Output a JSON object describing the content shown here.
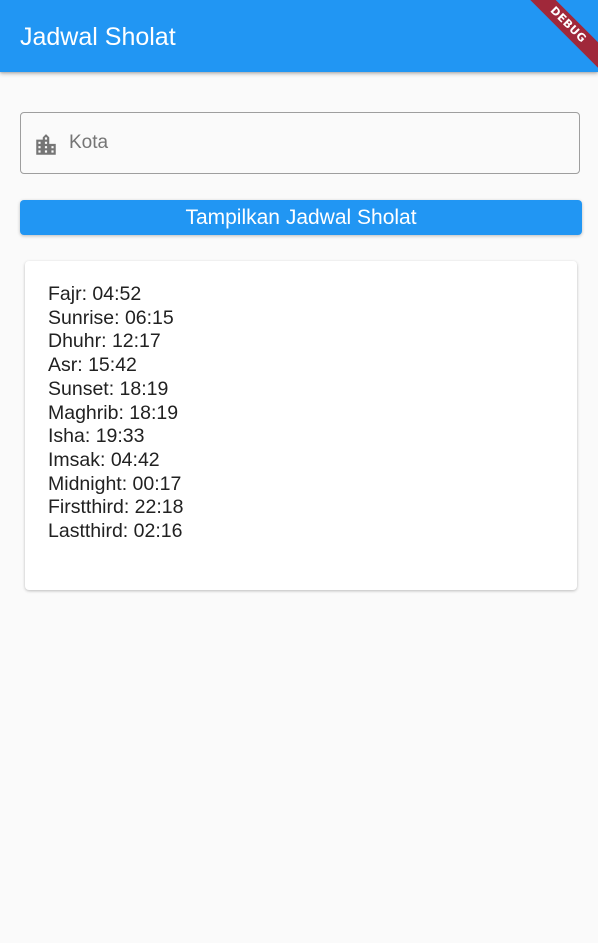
{
  "app_bar": {
    "title": "Jadwal Sholat",
    "color": "#2196f3"
  },
  "debug_banner": {
    "label": "DEBUG",
    "color": "#a0283a"
  },
  "city_field": {
    "icon": "location-city-icon",
    "placeholder": "Kota",
    "value": ""
  },
  "show_button": {
    "label": "Tampilkan Jadwal Sholat"
  },
  "schedule": [
    {
      "name": "Fajr",
      "time": "04:52",
      "text": "Fajr: 04:52"
    },
    {
      "name": "Sunrise",
      "time": "06:15",
      "text": "Sunrise: 06:15"
    },
    {
      "name": "Dhuhr",
      "time": "12:17",
      "text": "Dhuhr: 12:17"
    },
    {
      "name": "Asr",
      "time": "15:42",
      "text": "Asr: 15:42"
    },
    {
      "name": "Sunset",
      "time": "18:19",
      "text": "Sunset: 18:19"
    },
    {
      "name": "Maghrib",
      "time": "18:19",
      "text": "Maghrib: 18:19"
    },
    {
      "name": "Isha",
      "time": "19:33",
      "text": "Isha: 19:33"
    },
    {
      "name": "Imsak",
      "time": "04:42",
      "text": "Imsak: 04:42"
    },
    {
      "name": "Midnight",
      "time": "00:17",
      "text": "Midnight: 00:17"
    },
    {
      "name": "Firstthird",
      "time": "22:18",
      "text": "Firstthird: 22:18"
    },
    {
      "name": "Lastthird",
      "time": "02:16",
      "text": "Lastthird: 02:16"
    }
  ]
}
